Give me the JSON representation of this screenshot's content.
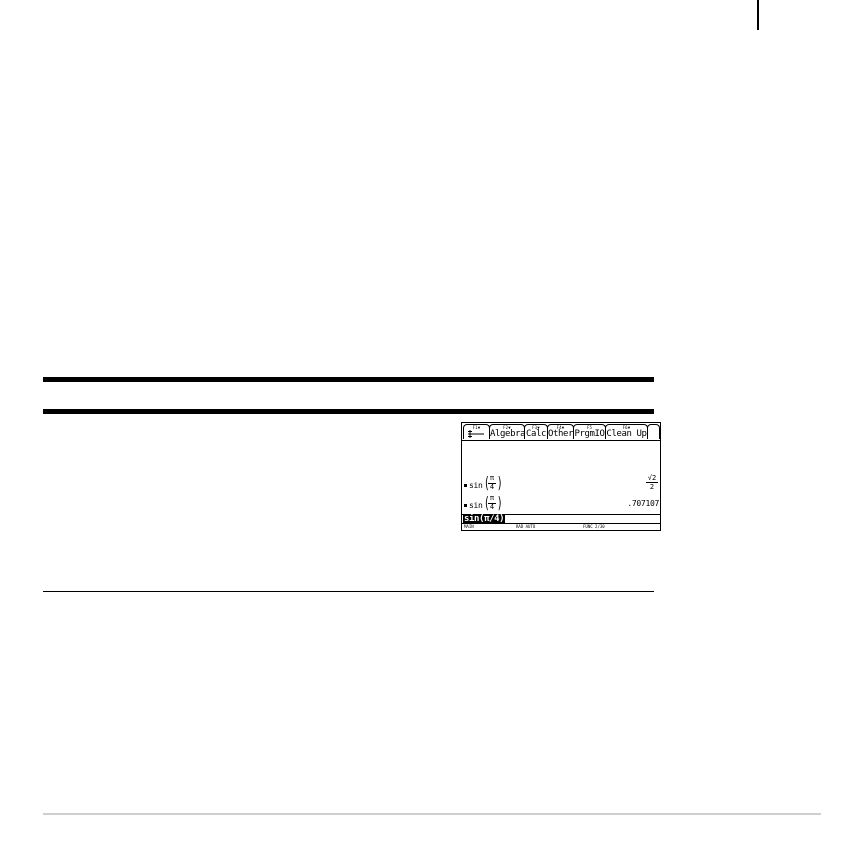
{
  "calculator": {
    "toolbar": {
      "f1": {
        "key": "F1▼",
        "label": ""
      },
      "f2": {
        "key": "F2▼",
        "label": "Algebra"
      },
      "f3": {
        "key": "F3▼",
        "label": "Calc"
      },
      "f4": {
        "key": "F4▼",
        "label": "Other"
      },
      "f5": {
        "key": "F5",
        "label": "PrgmIO"
      },
      "f6": {
        "key": "F6▼",
        "label": "Clean Up"
      }
    },
    "history": [
      {
        "func": "sin",
        "numerator": "π",
        "denominator": "4",
        "result_num": "√2",
        "result_den": "2"
      },
      {
        "func": "sin",
        "numerator": "π",
        "denominator": "4",
        "result": ".707107"
      }
    ],
    "entry_line": "sin(π/4)",
    "status": {
      "folder": "MAIN",
      "mode": "RAD AUTO",
      "info": "FUNC 2/30"
    }
  }
}
